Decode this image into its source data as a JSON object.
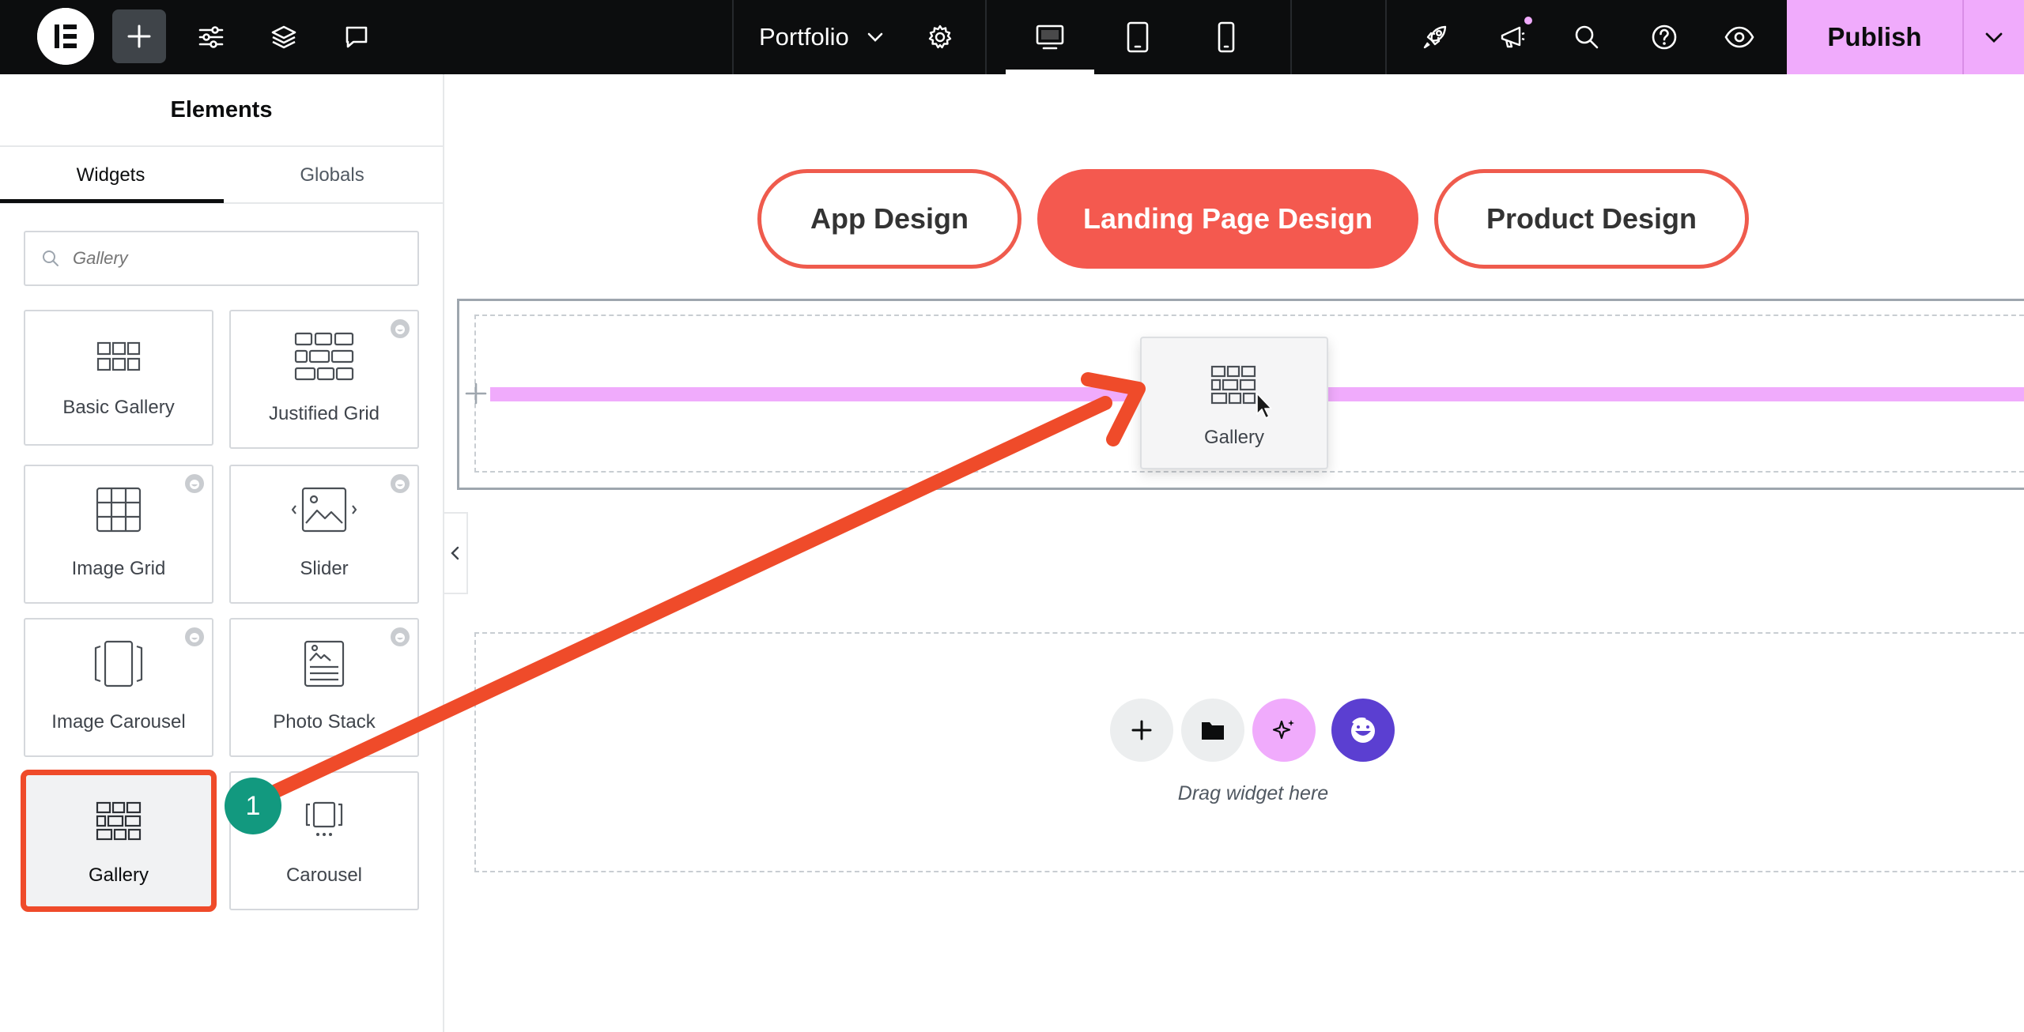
{
  "topbar": {
    "document_title": "Portfolio",
    "publish_label": "Publish",
    "accent_color": "#f0abfc"
  },
  "sidebar": {
    "title": "Elements",
    "tabs": [
      {
        "label": "Widgets",
        "active": true
      },
      {
        "label": "Globals",
        "active": false
      }
    ],
    "search": {
      "value": "",
      "placeholder": "Gallery"
    },
    "widgets": [
      {
        "label": "Basic Gallery",
        "icon": "basic-gallery-icon",
        "pro": false
      },
      {
        "label": "Justified Grid",
        "icon": "justified-grid-icon",
        "pro": true
      },
      {
        "label": "Image Grid",
        "icon": "image-grid-icon",
        "pro": true
      },
      {
        "label": "Slider",
        "icon": "slider-icon",
        "pro": true
      },
      {
        "label": "Image Carousel",
        "icon": "image-carousel-icon",
        "pro": true
      },
      {
        "label": "Photo Stack",
        "icon": "photo-stack-icon",
        "pro": true
      },
      {
        "label": "Gallery",
        "icon": "gallery-icon",
        "pro": false,
        "selected": true
      },
      {
        "label": "Carousel",
        "icon": "carousel-icon",
        "pro": false
      }
    ]
  },
  "canvas": {
    "filter_buttons": [
      {
        "label": "App Design",
        "active": false
      },
      {
        "label": "Landing Page Design",
        "active": true
      },
      {
        "label": "Product Design",
        "active": false
      }
    ],
    "drag_ghost_label": "Gallery",
    "drag_hint": "Drag widget here"
  },
  "annotation": {
    "step_number": "1",
    "highlight_color": "#ef4b2a",
    "badge_color": "#12997f"
  }
}
